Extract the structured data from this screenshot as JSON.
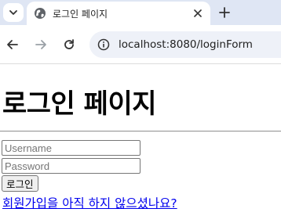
{
  "browser": {
    "tab": {
      "title": "로그인 페이지",
      "favicon": "globe-icon"
    },
    "address_bar": {
      "url": "localhost:8080/loginForm"
    }
  },
  "page": {
    "heading": "로그인 페이지",
    "form": {
      "username_placeholder": "Username",
      "password_placeholder": "Password",
      "submit_label": "로그인"
    },
    "signup_link": "회원가입을 아직 하지 않으셨나요?"
  },
  "colors": {
    "tabstrip": "#dfe6f4",
    "omnibox": "#eef1f8",
    "link": "#0000ee"
  }
}
